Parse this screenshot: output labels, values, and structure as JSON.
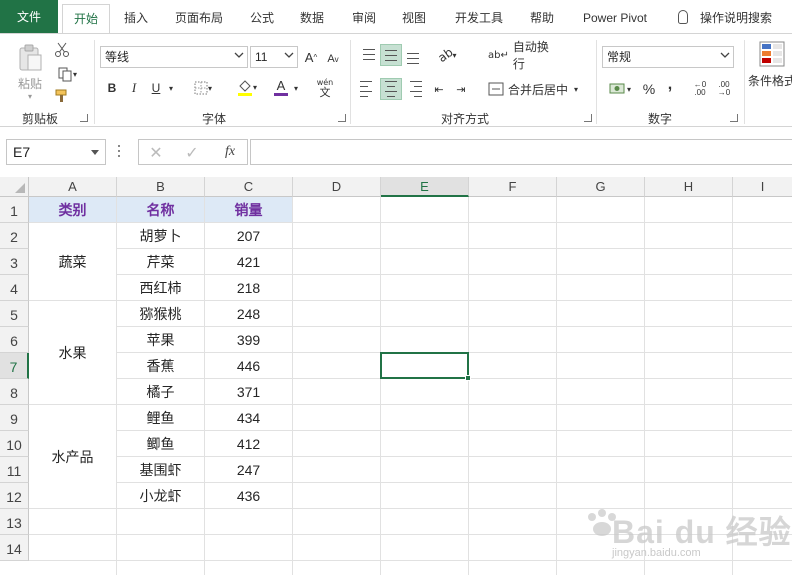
{
  "ribbon_tabs": {
    "file": "文件",
    "home": "开始",
    "insert": "插入",
    "page_layout": "页面布局",
    "formulas": "公式",
    "data": "数据",
    "review": "审阅",
    "view": "视图",
    "developer": "开发工具",
    "help": "帮助",
    "power_pivot": "Power Pivot",
    "tell_me": "操作说明搜索"
  },
  "clipboard": {
    "paste": "粘贴",
    "label": "剪贴板"
  },
  "font": {
    "name": "等线",
    "size": "11",
    "label": "字体",
    "bold": "B",
    "italic": "I",
    "underline": "U",
    "grow": "A",
    "shrink": "A",
    "font_color": "A",
    "phonetic": "wén"
  },
  "alignment": {
    "wrap": "自动换行",
    "merge": "合并后居中",
    "label": "对齐方式"
  },
  "number": {
    "format": "常规",
    "percent": "%",
    "comma": ",",
    "label": "数字"
  },
  "styles": {
    "conditional": "条件格式"
  },
  "formula_bar": {
    "name_box": "E7",
    "fx": "fx",
    "formula": ""
  },
  "columns": [
    "A",
    "B",
    "C",
    "D",
    "E",
    "F",
    "G",
    "H",
    "I"
  ],
  "rows": [
    "1",
    "2",
    "3",
    "4",
    "5",
    "6",
    "7",
    "8",
    "9",
    "10",
    "11",
    "12",
    "13",
    "14"
  ],
  "selected_cell": "E7",
  "table": {
    "headers": [
      "类别",
      "名称",
      "销量"
    ],
    "groups": [
      {
        "category": "蔬菜",
        "items": [
          [
            "胡萝卜",
            "207"
          ],
          [
            "芹菜",
            "421"
          ],
          [
            "西红柿",
            "218"
          ]
        ]
      },
      {
        "category": "水果",
        "items": [
          [
            "猕猴桃",
            "248"
          ],
          [
            "苹果",
            "399"
          ],
          [
            "香蕉",
            "446"
          ],
          [
            "橘子",
            "371"
          ]
        ]
      },
      {
        "category": "水产品",
        "items": [
          [
            "鲤鱼",
            "434"
          ],
          [
            "鲫鱼",
            "412"
          ],
          [
            "基围虾",
            "247"
          ],
          [
            "小龙虾",
            "436"
          ]
        ]
      }
    ]
  },
  "colors": {
    "accent": "#217346",
    "header_fill": "#dde9f6",
    "header_text": "#7030a0"
  },
  "watermark": {
    "brand": "Bai du 经验",
    "url": "jingyan.baidu.com"
  }
}
